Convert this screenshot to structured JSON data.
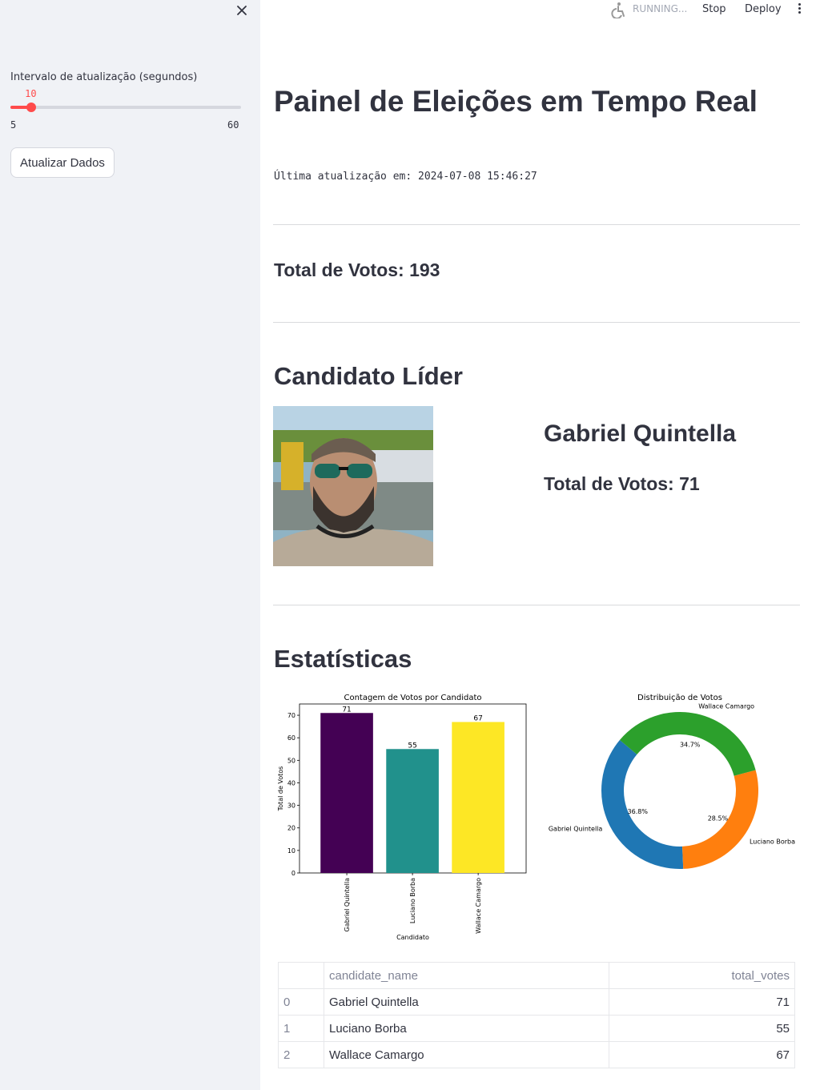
{
  "sidebar": {
    "slider_label": "Intervalo de atualização (segundos)",
    "slider_value": 10,
    "slider_min": 5,
    "slider_max": 60,
    "refresh_button": "Atualizar Dados"
  },
  "topbar": {
    "status": "RUNNING...",
    "stop": "Stop",
    "deploy": "Deploy"
  },
  "main": {
    "title": "Painel de Eleições em Tempo Real",
    "last_update": "Última atualização em: 2024-07-08 15:46:27",
    "total_votes": "Total de Votos: 193",
    "leader_heading": "Candidato Líder",
    "leader_name": "Gabriel Quintella",
    "leader_votes": "Total de Votos: 71",
    "stats_heading": "Estatísticas"
  },
  "chart_data": [
    {
      "type": "bar",
      "title": "Contagem de Votos por Candidato",
      "xlabel": "Candidato",
      "ylabel": "Total de Votos",
      "categories": [
        "Gabriel Quintella",
        "Luciano Borba",
        "Wallace Camargo"
      ],
      "values": [
        71,
        55,
        67
      ],
      "colors": [
        "#440154",
        "#21918c",
        "#fde725"
      ],
      "ylim": [
        0,
        75
      ],
      "yticks": [
        0,
        10,
        20,
        30,
        40,
        50,
        60,
        70
      ]
    },
    {
      "type": "pie",
      "title": "Distribuição de Votos",
      "labels": [
        "Gabriel Quintella",
        "Luciano Borba",
        "Wallace Camargo"
      ],
      "values": [
        36.8,
        28.5,
        34.7
      ],
      "pct_labels": [
        "36.8%",
        "28.5%",
        "34.7%"
      ],
      "colors": [
        "#1f77b4",
        "#ff7f0e",
        "#2ca02c"
      ]
    }
  ],
  "table": {
    "columns": [
      "",
      "candidate_name",
      "total_votes"
    ],
    "rows": [
      [
        "0",
        "Gabriel Quintella",
        "71"
      ],
      [
        "1",
        "Luciano Borba",
        "55"
      ],
      [
        "2",
        "Wallace Camargo",
        "67"
      ]
    ]
  }
}
